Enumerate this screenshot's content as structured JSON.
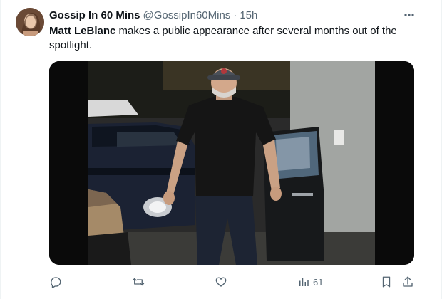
{
  "tweet": {
    "display_name": "Gossip In 60 Mins",
    "handle": "@GossipIn60Mins",
    "separator": "·",
    "time": "15h",
    "text_mention": "Matt LeBlanc",
    "text_rest": " makes a public appearance after several months out of the spotlight.",
    "media_description_icon": "photo"
  },
  "actions": {
    "reply_icon": "reply-icon",
    "retweet_icon": "retweet-icon",
    "like_icon": "like-icon",
    "views_icon": "views-icon",
    "views_count": "61",
    "bookmark_icon": "bookmark-icon",
    "share_icon": "share-icon"
  },
  "colors": {
    "text_primary": "#0f1419",
    "text_secondary": "#536471",
    "divider": "#eff3f4"
  }
}
